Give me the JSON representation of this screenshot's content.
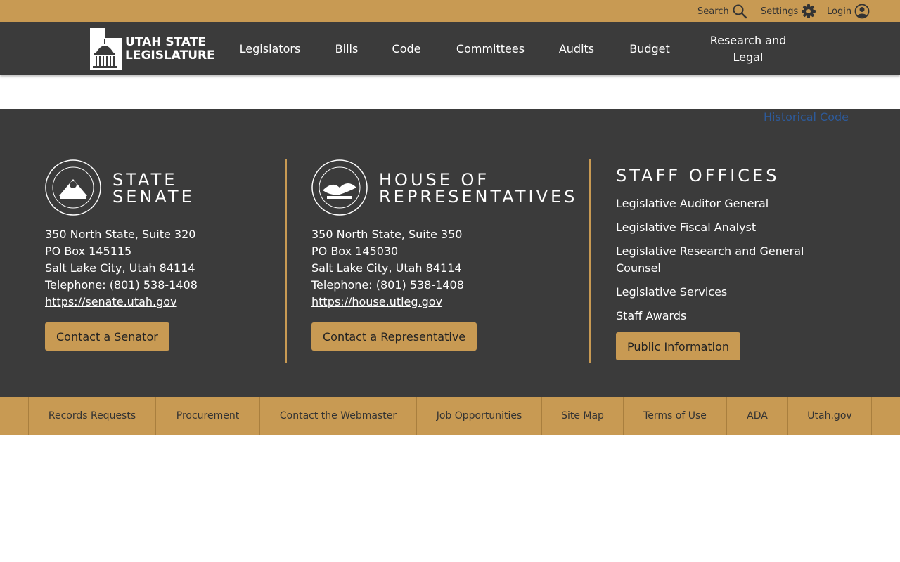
{
  "utility": {
    "search_label": "Search",
    "settings_label": "Settings",
    "login_label": "Login"
  },
  "logo": {
    "line1": "UTAH STATE",
    "line2": "LEGISLATURE"
  },
  "nav": {
    "items": [
      "Legislators",
      "Bills",
      "Code",
      "Committees",
      "Audits",
      "Budget",
      "Research and Legal"
    ]
  },
  "historical_link": "Historical Code",
  "senate": {
    "title_line1": "STATE",
    "title_line2": "SENATE",
    "address1": "350 North State, Suite 320",
    "address2": "PO Box 145115",
    "city": "Salt Lake City, Utah 84114",
    "phone": "Telephone: (801) 538-1408",
    "website": "https://senate.utah.gov",
    "button": "Contact a Senator"
  },
  "house": {
    "title_line1": "HOUSE OF",
    "title_line2": "REPRESENTATIVES",
    "address1": "350 North State, Suite 350",
    "address2": "PO Box 145030",
    "city": "Salt Lake City, Utah 84114",
    "phone": "Telephone: (801) 538-1408",
    "website": "https://house.utleg.gov",
    "button": "Contact a Representative"
  },
  "staff": {
    "title": "STAFF OFFICES",
    "links": [
      "Legislative Auditor General",
      "Legislative Fiscal Analyst",
      "Legislative Research and General Counsel",
      "Legislative Services",
      "Staff Awards"
    ],
    "button": "Public Information"
  },
  "bottom_links": [
    "Records Requests",
    "Procurement",
    "Contact the Webmaster",
    "Job Opportunities",
    "Site Map",
    "Terms of Use",
    "ADA",
    "Utah.gov"
  ],
  "colors": {
    "gold": "#c89a53",
    "dark": "#3b3b3b"
  }
}
